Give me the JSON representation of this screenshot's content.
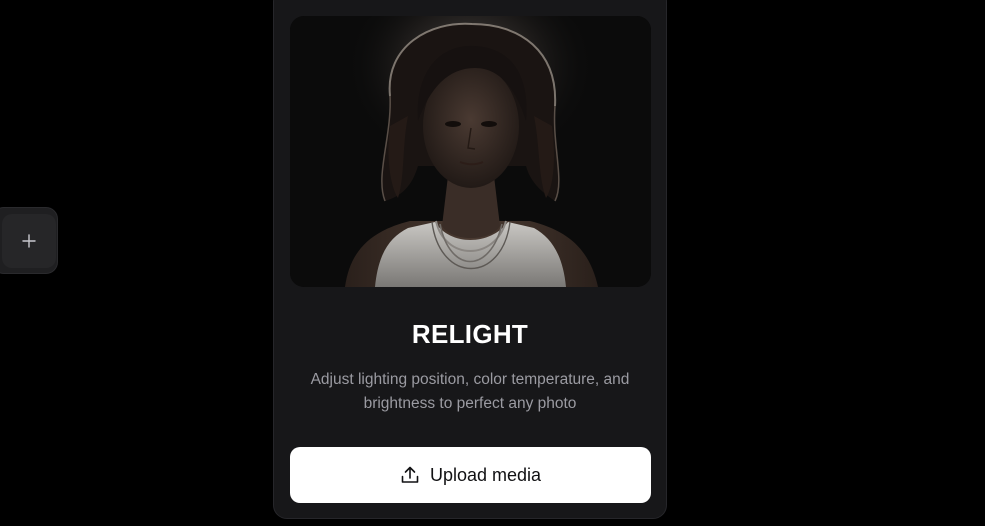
{
  "side_button": {
    "icon": "plus-icon",
    "glyph": "+"
  },
  "card": {
    "title": "RELIGHT",
    "description": "Adjust lighting position, color temperature, and brightness to perfect any photo",
    "upload_label": "Upload media",
    "upload_icon": "upload-icon",
    "preview_image": "portrait-backlit-woman"
  },
  "colors": {
    "background": "#000000",
    "card": "#171719",
    "title": "#ffffff",
    "description": "#9b9ba2",
    "button": "#ffffff",
    "button_text": "#111113"
  }
}
